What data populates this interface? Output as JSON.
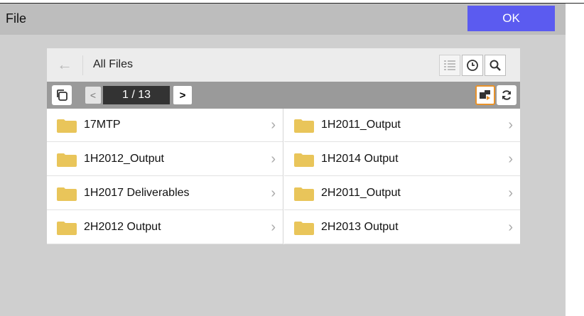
{
  "window": {
    "title": "File",
    "ok_label": "OK"
  },
  "browser": {
    "path": "All Files",
    "page_indicator": "1 / 13",
    "prev_label": "<",
    "next_label": ">"
  },
  "items": [
    {
      "name": "17MTP"
    },
    {
      "name": "1H2011_Output"
    },
    {
      "name": "1H2012_Output"
    },
    {
      "name": "1H2014 Output"
    },
    {
      "name": "1H2017 Deliverables"
    },
    {
      "name": "2H2011_Output"
    },
    {
      "name": "2H2012 Output"
    },
    {
      "name": "2H2013 Output"
    }
  ],
  "icons": {
    "back": "arrow-left-icon",
    "list_view": "list-view-icon",
    "recent": "clock-icon",
    "search": "search-icon",
    "copy": "copy-icon",
    "move": "move-icon",
    "refresh": "refresh-icon",
    "folder": "folder-icon",
    "chevron": "chevron-right-icon"
  },
  "colors": {
    "ok_button": "#5b5bf0",
    "folder": "#e9c55a",
    "active_outline": "#e8922a"
  }
}
